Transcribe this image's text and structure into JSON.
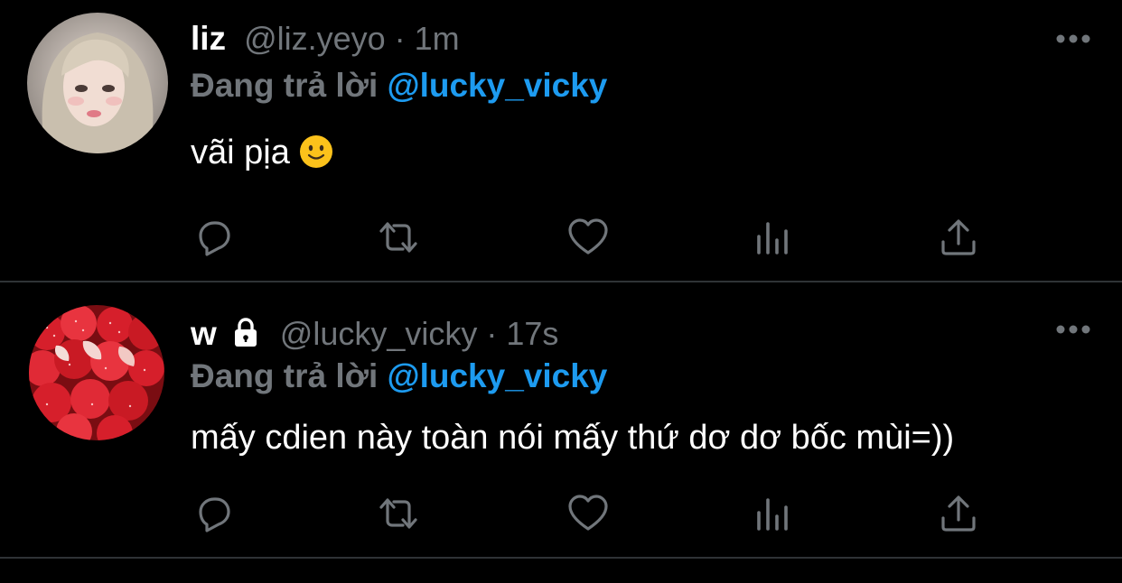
{
  "tweets": [
    {
      "name": "liz",
      "handle": "@liz.yeyo",
      "separator": "·",
      "time": "1m",
      "reply_prefix": "Đang trả lời",
      "reply_mention": "@lucky_vicky",
      "text": "vãi pịa",
      "has_emoji": "slightly-smiling-face",
      "locked": false,
      "avatar": "portrait-photo-avatar"
    },
    {
      "name": "w",
      "handle": "@lucky_vicky",
      "separator": "·",
      "time": "17s",
      "reply_prefix": "Đang trả lời",
      "reply_mention": "@lucky_vicky",
      "text": "mấy cdien này toàn nói mấy thứ dơ dơ bốc mùi=))",
      "locked": true,
      "avatar": "strawberries-photo-avatar"
    }
  ],
  "icons": {
    "more": "more-horizontal-icon",
    "reply": "reply-icon",
    "retweet": "retweet-icon",
    "like": "heart-icon",
    "views": "views-chart-icon",
    "share": "share-icon",
    "lock": "lock-icon"
  },
  "colors": {
    "background": "#000000",
    "text_primary": "#ffffff",
    "text_secondary": "#71767b",
    "accent": "#1d9bf0",
    "divider": "#2f3336"
  }
}
